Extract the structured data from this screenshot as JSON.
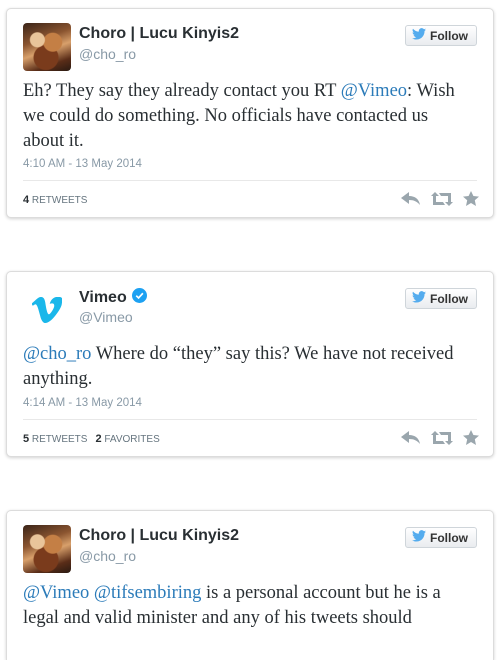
{
  "colors": {
    "link": "#2b7bb9",
    "verified": "#1da1f2",
    "twitter_bird": "#55acee",
    "vimeo": "#1ab7ea"
  },
  "tweets": [
    {
      "name": "Choro | Lucu Kinyis2",
      "handle": "@cho_ro",
      "verified": false,
      "avatar": "photo-avatar",
      "follow_label": "Follow",
      "text_parts": [
        {
          "text": "Eh? They say they already contact you RT ",
          "link": false
        },
        {
          "text": "@Vimeo",
          "link": true
        },
        {
          "text": ": Wish we could do something. No officials have contacted us about it.",
          "link": false
        }
      ],
      "timestamp": "4:10 AM - 13 May 2014",
      "retweets": "4",
      "retweets_label": "RETWEETS",
      "favorites": "",
      "favorites_label": ""
    },
    {
      "name": "Vimeo",
      "handle": "@Vimeo",
      "verified": true,
      "avatar": "vimeo-logo",
      "follow_label": "Follow",
      "text_parts": [
        {
          "text": "@cho_ro",
          "link": true
        },
        {
          "text": " Where do “they” say this? We have not received anything.",
          "link": false
        }
      ],
      "timestamp": "4:14 AM - 13 May 2014",
      "retweets": "5",
      "retweets_label": "RETWEETS",
      "favorites": "2",
      "favorites_label": "FAVORITES"
    },
    {
      "name": "Choro | Lucu Kinyis2",
      "handle": "@cho_ro",
      "verified": false,
      "avatar": "photo-avatar",
      "follow_label": "Follow",
      "text_parts": [
        {
          "text": "@Vimeo",
          "link": true
        },
        {
          "text": " ",
          "link": false
        },
        {
          "text": "@tifsembiring",
          "link": true
        },
        {
          "text": " is a personal account but he is a legal and valid minister and any of his tweets should",
          "link": false
        }
      ]
    }
  ],
  "icons": [
    "twitter-bird-icon",
    "verified-badge-icon",
    "reply-icon",
    "retweet-icon",
    "favorite-star-icon"
  ]
}
